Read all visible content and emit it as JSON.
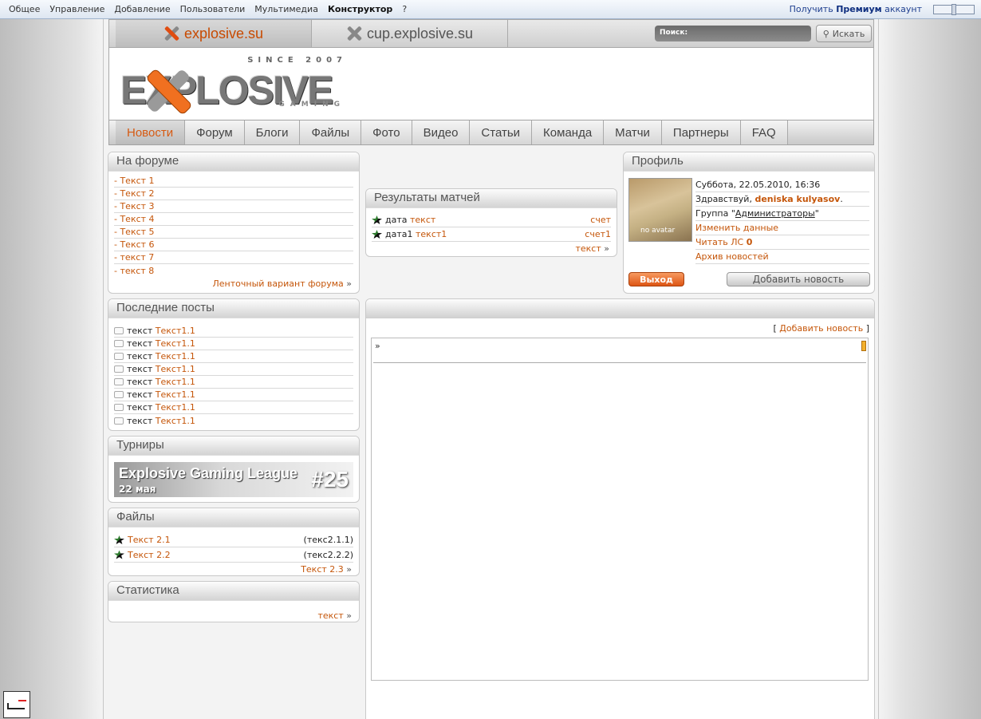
{
  "topbar": {
    "menu": [
      "Общее",
      "Управление",
      "Добавление",
      "Пользователи",
      "Мультимедиа",
      "Конструктор",
      "?"
    ],
    "premium_pre": "Получить",
    "premium_b": "Премиум",
    "premium_post": "аккаунт"
  },
  "sites": {
    "tab1": "explosive.su",
    "tab2": "cup.explosive.su",
    "search_label": "Поиск:",
    "search_button": "Искать"
  },
  "logo": {
    "since": "SINCE 2007",
    "main": "EXPLOSIVE",
    "gaming": "GAMING"
  },
  "nav": [
    "Новости",
    "Форум",
    "Блоги",
    "Файлы",
    "Фото",
    "Видео",
    "Статьи",
    "Команда",
    "Матчи",
    "Партнеры",
    "FAQ"
  ],
  "forum": {
    "title": "На форуме",
    "items": [
      "- Текст 1",
      "- Текст 2",
      "- Текст 3",
      "- Текст 4",
      "- Текст 5",
      "- Текст 6",
      "- текст 7",
      "- текст 8"
    ],
    "more": "Ленточный вариант форума"
  },
  "posts": {
    "title": "Последние посты",
    "prefix": "текст",
    "link": "Текст1.1"
  },
  "tourn": {
    "title": "Турниры",
    "banner": "Explosive Gaming League",
    "date": "22 мая",
    "num": "#25"
  },
  "files": {
    "title": "Файлы",
    "items": [
      {
        "name": "Текст 2.1",
        "size": "(текс2.1.1)"
      },
      {
        "name": "Текст 2.2",
        "size": "(текс2.2.2)"
      }
    ],
    "more": "Текст 2.3"
  },
  "stats": {
    "title": "Статистика",
    "more": "текст"
  },
  "matches": {
    "title": "Результаты матчей",
    "rows": [
      {
        "date": "дата",
        "text": "текст",
        "score": "счет"
      },
      {
        "date": "дата1",
        "text": "текст1",
        "score": "счет1"
      }
    ],
    "more": "текст"
  },
  "profile": {
    "title": "Профиль",
    "date": "Суббота, 22.05.2010, 16:36",
    "greet": "Здравствуй,",
    "user": "deniska kulyasov",
    "group_pre": "Группа \"",
    "group": "Администраторы",
    "group_post": "\"",
    "edit": "Изменить данные",
    "pm": "Читать ЛС",
    "pm_count": "0",
    "archive": "Архив новостей",
    "avatar": "no avatar",
    "logout": "Выход",
    "add": "Добавить новость"
  },
  "main": {
    "add_news": "Добавить новость",
    "open": "[",
    "close": "]"
  }
}
